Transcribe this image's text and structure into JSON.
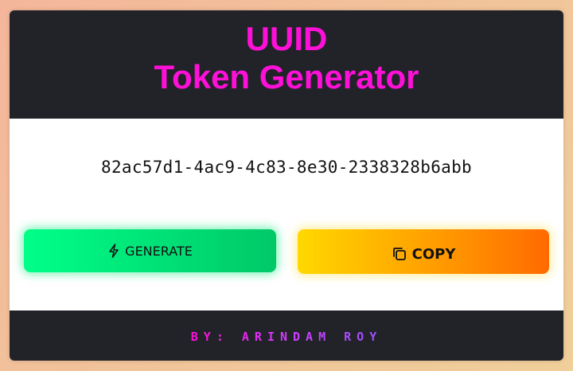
{
  "header": {
    "title_line1": "UUID",
    "title_line2": "Token Generator"
  },
  "token": {
    "value": "82ac57d1-4ac9-4c83-8e30-2338328b6abb"
  },
  "buttons": {
    "generate_label": "GENERATE",
    "generate_icon": "lightning-icon",
    "copy_label": "COPY",
    "copy_icon": "copy-icon"
  },
  "footer": {
    "credit": "BY: ARINDAM ROY"
  },
  "colors": {
    "title": "#ff10d8",
    "panel_dark": "#212329",
    "generate_start": "#00ff88",
    "generate_end": "#00c868",
    "copy_start": "#ffd800",
    "copy_end": "#ff6a00"
  }
}
